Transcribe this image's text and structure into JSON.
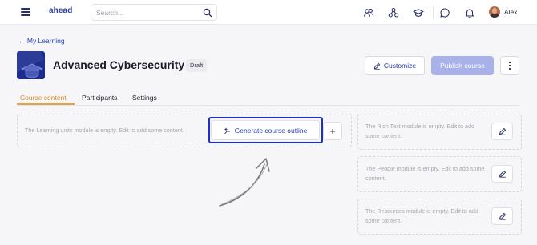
{
  "topbar": {
    "logo": "ahead",
    "search_placeholder": "Search...",
    "icons": [
      "menu-icon",
      "search-icon",
      "people-icon",
      "network-icon",
      "graduation-cap-icon",
      "chat-icon",
      "bell-icon"
    ],
    "user_name": "Alex"
  },
  "header": {
    "back_label": "← My Learning",
    "course_title": "Advanced Cybersecurity",
    "status_badge": "Draft",
    "customize_label": "Customize",
    "publish_label": "Publish course"
  },
  "tabs": [
    {
      "label": "Course content",
      "active": true
    },
    {
      "label": "Participants",
      "active": false
    },
    {
      "label": "Settings",
      "active": false
    }
  ],
  "modules": {
    "learning_units": {
      "empty_text": "The Learning units module is empty. Edit to add some content.",
      "generate_label": "Generate course outline",
      "add_label": "+"
    },
    "rich_text": {
      "empty_text": "The Rich Text module is empty. Edit to add some content."
    },
    "people": {
      "empty_text": "The People module is empty. Edit to add some content."
    },
    "resources": {
      "empty_text": "The Resources module is empty. Edit to add some content."
    }
  },
  "colors": {
    "accent": "#2b3fa8",
    "active_tab": "#d98a1e",
    "highlight": "#1d2fc8",
    "publish_disabled": "#a9b2e8"
  }
}
